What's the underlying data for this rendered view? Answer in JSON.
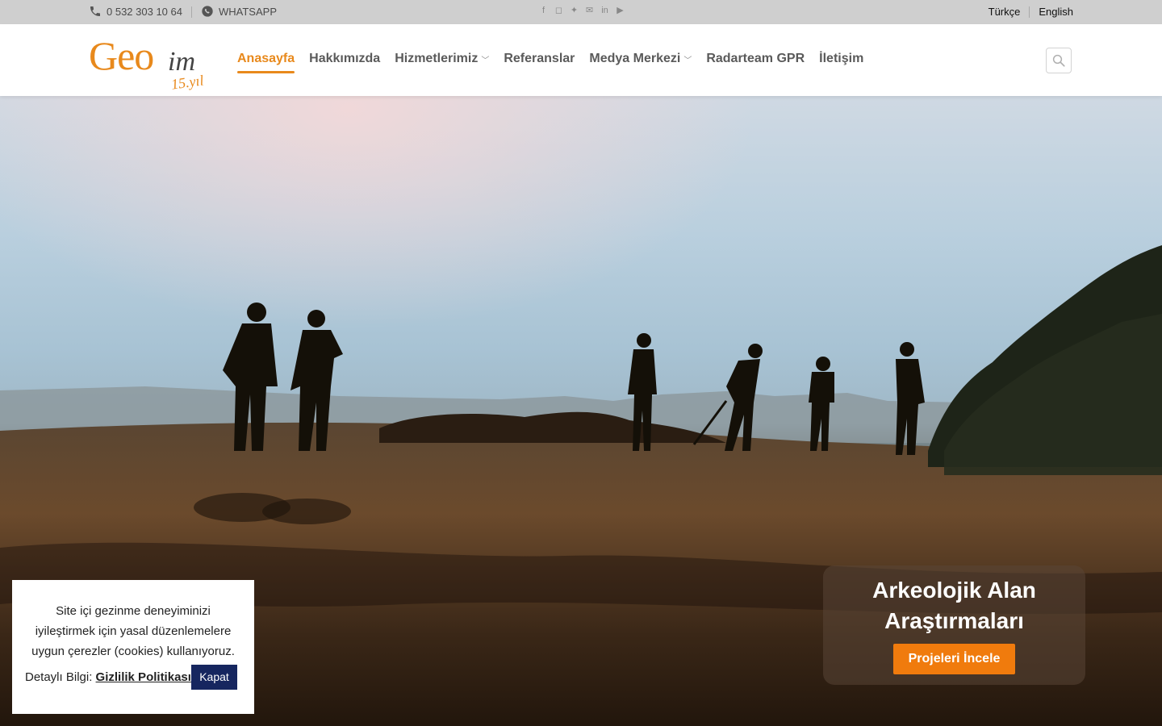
{
  "topbar": {
    "phone": "0 532 303 10 64",
    "whatsapp": "WHATSAPP",
    "social_icons": [
      "facebook-icon",
      "instagram-icon",
      "twitter-icon",
      "envelope-icon",
      "linkedin-icon",
      "youtube-icon"
    ],
    "languages": [
      "Türkçe",
      "English"
    ]
  },
  "header": {
    "logo": {
      "main": "Geo",
      "accent": "im",
      "sub": "15.yıl"
    },
    "nav": [
      {
        "label": "Anasayfa",
        "active": true,
        "dropdown": false
      },
      {
        "label": "Hakkımızda",
        "active": false,
        "dropdown": false
      },
      {
        "label": "Hizmetlerimiz",
        "active": false,
        "dropdown": true
      },
      {
        "label": "Referanslar",
        "active": false,
        "dropdown": false
      },
      {
        "label": "Medya Merkezi",
        "active": false,
        "dropdown": true
      },
      {
        "label": "Radarteam GPR",
        "active": false,
        "dropdown": false
      },
      {
        "label": "İletişim",
        "active": false,
        "dropdown": false
      }
    ]
  },
  "hero": {
    "title_line1": "Arkeolojik Alan",
    "title_line2": "Araştırmaları",
    "button": "Projeleri İncele"
  },
  "cookie": {
    "message": "Site içi gezinme deneyiminizi iyileştirmek için yasal düzenlemelere uygun çerezler (cookies) kullanıyoruz.",
    "detail_prefix": "Detaylı Bilgi:",
    "policy_link": "Gizlilik Politikası",
    "close": "Kapat"
  },
  "colors": {
    "accent": "#e8891c",
    "button": "#f07b0d",
    "cookie_button": "#16265f",
    "topbar": "#cfcfcf"
  }
}
